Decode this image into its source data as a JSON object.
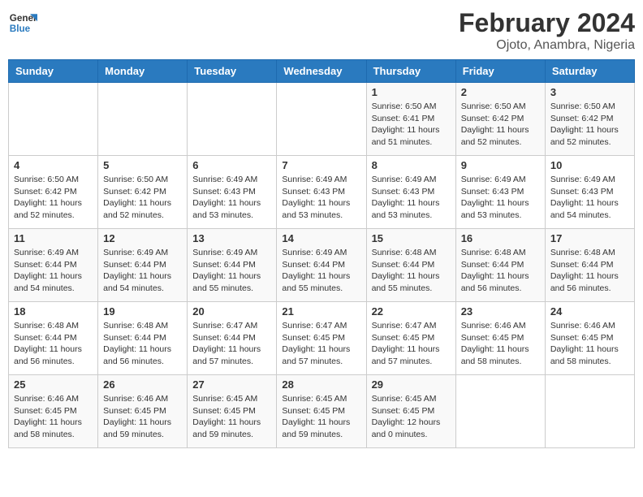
{
  "logo": {
    "text_general": "General",
    "text_blue": "Blue"
  },
  "title": "February 2024",
  "subtitle": "Ojoto, Anambra, Nigeria",
  "days_of_week": [
    "Sunday",
    "Monday",
    "Tuesday",
    "Wednesday",
    "Thursday",
    "Friday",
    "Saturday"
  ],
  "weeks": [
    [
      {
        "day": "",
        "sunrise": "",
        "sunset": "",
        "daylight": ""
      },
      {
        "day": "",
        "sunrise": "",
        "sunset": "",
        "daylight": ""
      },
      {
        "day": "",
        "sunrise": "",
        "sunset": "",
        "daylight": ""
      },
      {
        "day": "",
        "sunrise": "",
        "sunset": "",
        "daylight": ""
      },
      {
        "day": "1",
        "sunrise": "6:50 AM",
        "sunset": "6:41 PM",
        "daylight": "11 hours and 51 minutes."
      },
      {
        "day": "2",
        "sunrise": "6:50 AM",
        "sunset": "6:42 PM",
        "daylight": "11 hours and 52 minutes."
      },
      {
        "day": "3",
        "sunrise": "6:50 AM",
        "sunset": "6:42 PM",
        "daylight": "11 hours and 52 minutes."
      }
    ],
    [
      {
        "day": "4",
        "sunrise": "6:50 AM",
        "sunset": "6:42 PM",
        "daylight": "11 hours and 52 minutes."
      },
      {
        "day": "5",
        "sunrise": "6:50 AM",
        "sunset": "6:42 PM",
        "daylight": "11 hours and 52 minutes."
      },
      {
        "day": "6",
        "sunrise": "6:49 AM",
        "sunset": "6:43 PM",
        "daylight": "11 hours and 53 minutes."
      },
      {
        "day": "7",
        "sunrise": "6:49 AM",
        "sunset": "6:43 PM",
        "daylight": "11 hours and 53 minutes."
      },
      {
        "day": "8",
        "sunrise": "6:49 AM",
        "sunset": "6:43 PM",
        "daylight": "11 hours and 53 minutes."
      },
      {
        "day": "9",
        "sunrise": "6:49 AM",
        "sunset": "6:43 PM",
        "daylight": "11 hours and 53 minutes."
      },
      {
        "day": "10",
        "sunrise": "6:49 AM",
        "sunset": "6:43 PM",
        "daylight": "11 hours and 54 minutes."
      }
    ],
    [
      {
        "day": "11",
        "sunrise": "6:49 AM",
        "sunset": "6:44 PM",
        "daylight": "11 hours and 54 minutes."
      },
      {
        "day": "12",
        "sunrise": "6:49 AM",
        "sunset": "6:44 PM",
        "daylight": "11 hours and 54 minutes."
      },
      {
        "day": "13",
        "sunrise": "6:49 AM",
        "sunset": "6:44 PM",
        "daylight": "11 hours and 55 minutes."
      },
      {
        "day": "14",
        "sunrise": "6:49 AM",
        "sunset": "6:44 PM",
        "daylight": "11 hours and 55 minutes."
      },
      {
        "day": "15",
        "sunrise": "6:48 AM",
        "sunset": "6:44 PM",
        "daylight": "11 hours and 55 minutes."
      },
      {
        "day": "16",
        "sunrise": "6:48 AM",
        "sunset": "6:44 PM",
        "daylight": "11 hours and 56 minutes."
      },
      {
        "day": "17",
        "sunrise": "6:48 AM",
        "sunset": "6:44 PM",
        "daylight": "11 hours and 56 minutes."
      }
    ],
    [
      {
        "day": "18",
        "sunrise": "6:48 AM",
        "sunset": "6:44 PM",
        "daylight": "11 hours and 56 minutes."
      },
      {
        "day": "19",
        "sunrise": "6:48 AM",
        "sunset": "6:44 PM",
        "daylight": "11 hours and 56 minutes."
      },
      {
        "day": "20",
        "sunrise": "6:47 AM",
        "sunset": "6:44 PM",
        "daylight": "11 hours and 57 minutes."
      },
      {
        "day": "21",
        "sunrise": "6:47 AM",
        "sunset": "6:45 PM",
        "daylight": "11 hours and 57 minutes."
      },
      {
        "day": "22",
        "sunrise": "6:47 AM",
        "sunset": "6:45 PM",
        "daylight": "11 hours and 57 minutes."
      },
      {
        "day": "23",
        "sunrise": "6:46 AM",
        "sunset": "6:45 PM",
        "daylight": "11 hours and 58 minutes."
      },
      {
        "day": "24",
        "sunrise": "6:46 AM",
        "sunset": "6:45 PM",
        "daylight": "11 hours and 58 minutes."
      }
    ],
    [
      {
        "day": "25",
        "sunrise": "6:46 AM",
        "sunset": "6:45 PM",
        "daylight": "11 hours and 58 minutes."
      },
      {
        "day": "26",
        "sunrise": "6:46 AM",
        "sunset": "6:45 PM",
        "daylight": "11 hours and 59 minutes."
      },
      {
        "day": "27",
        "sunrise": "6:45 AM",
        "sunset": "6:45 PM",
        "daylight": "11 hours and 59 minutes."
      },
      {
        "day": "28",
        "sunrise": "6:45 AM",
        "sunset": "6:45 PM",
        "daylight": "11 hours and 59 minutes."
      },
      {
        "day": "29",
        "sunrise": "6:45 AM",
        "sunset": "6:45 PM",
        "daylight": "12 hours and 0 minutes."
      },
      {
        "day": "",
        "sunrise": "",
        "sunset": "",
        "daylight": ""
      },
      {
        "day": "",
        "sunrise": "",
        "sunset": "",
        "daylight": ""
      }
    ]
  ]
}
